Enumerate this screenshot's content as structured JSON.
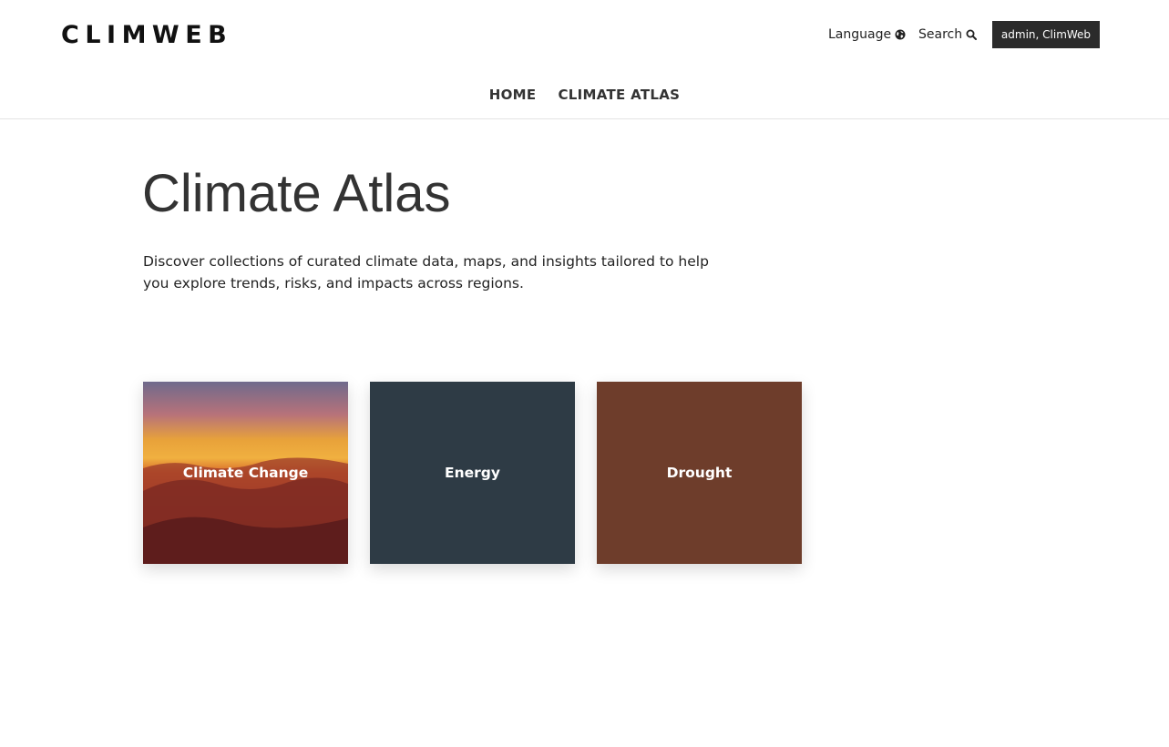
{
  "header": {
    "logo": "CLIMWEB",
    "language_label": "Language",
    "search_label": "Search",
    "user_label": "admin, ClimWeb"
  },
  "nav": {
    "items": [
      {
        "label": "HOME"
      },
      {
        "label": "CLIMATE ATLAS"
      }
    ]
  },
  "main": {
    "title": "Climate Atlas",
    "intro": "Discover collections of curated climate data, maps, and insights tailored to help you explore trends, risks, and impacts across regions.",
    "cards": [
      {
        "label": "Climate Change",
        "color": "#8a2e24"
      },
      {
        "label": "Energy",
        "color": "#2e3b45"
      },
      {
        "label": "Drought",
        "color": "#6e3d2b"
      }
    ]
  }
}
